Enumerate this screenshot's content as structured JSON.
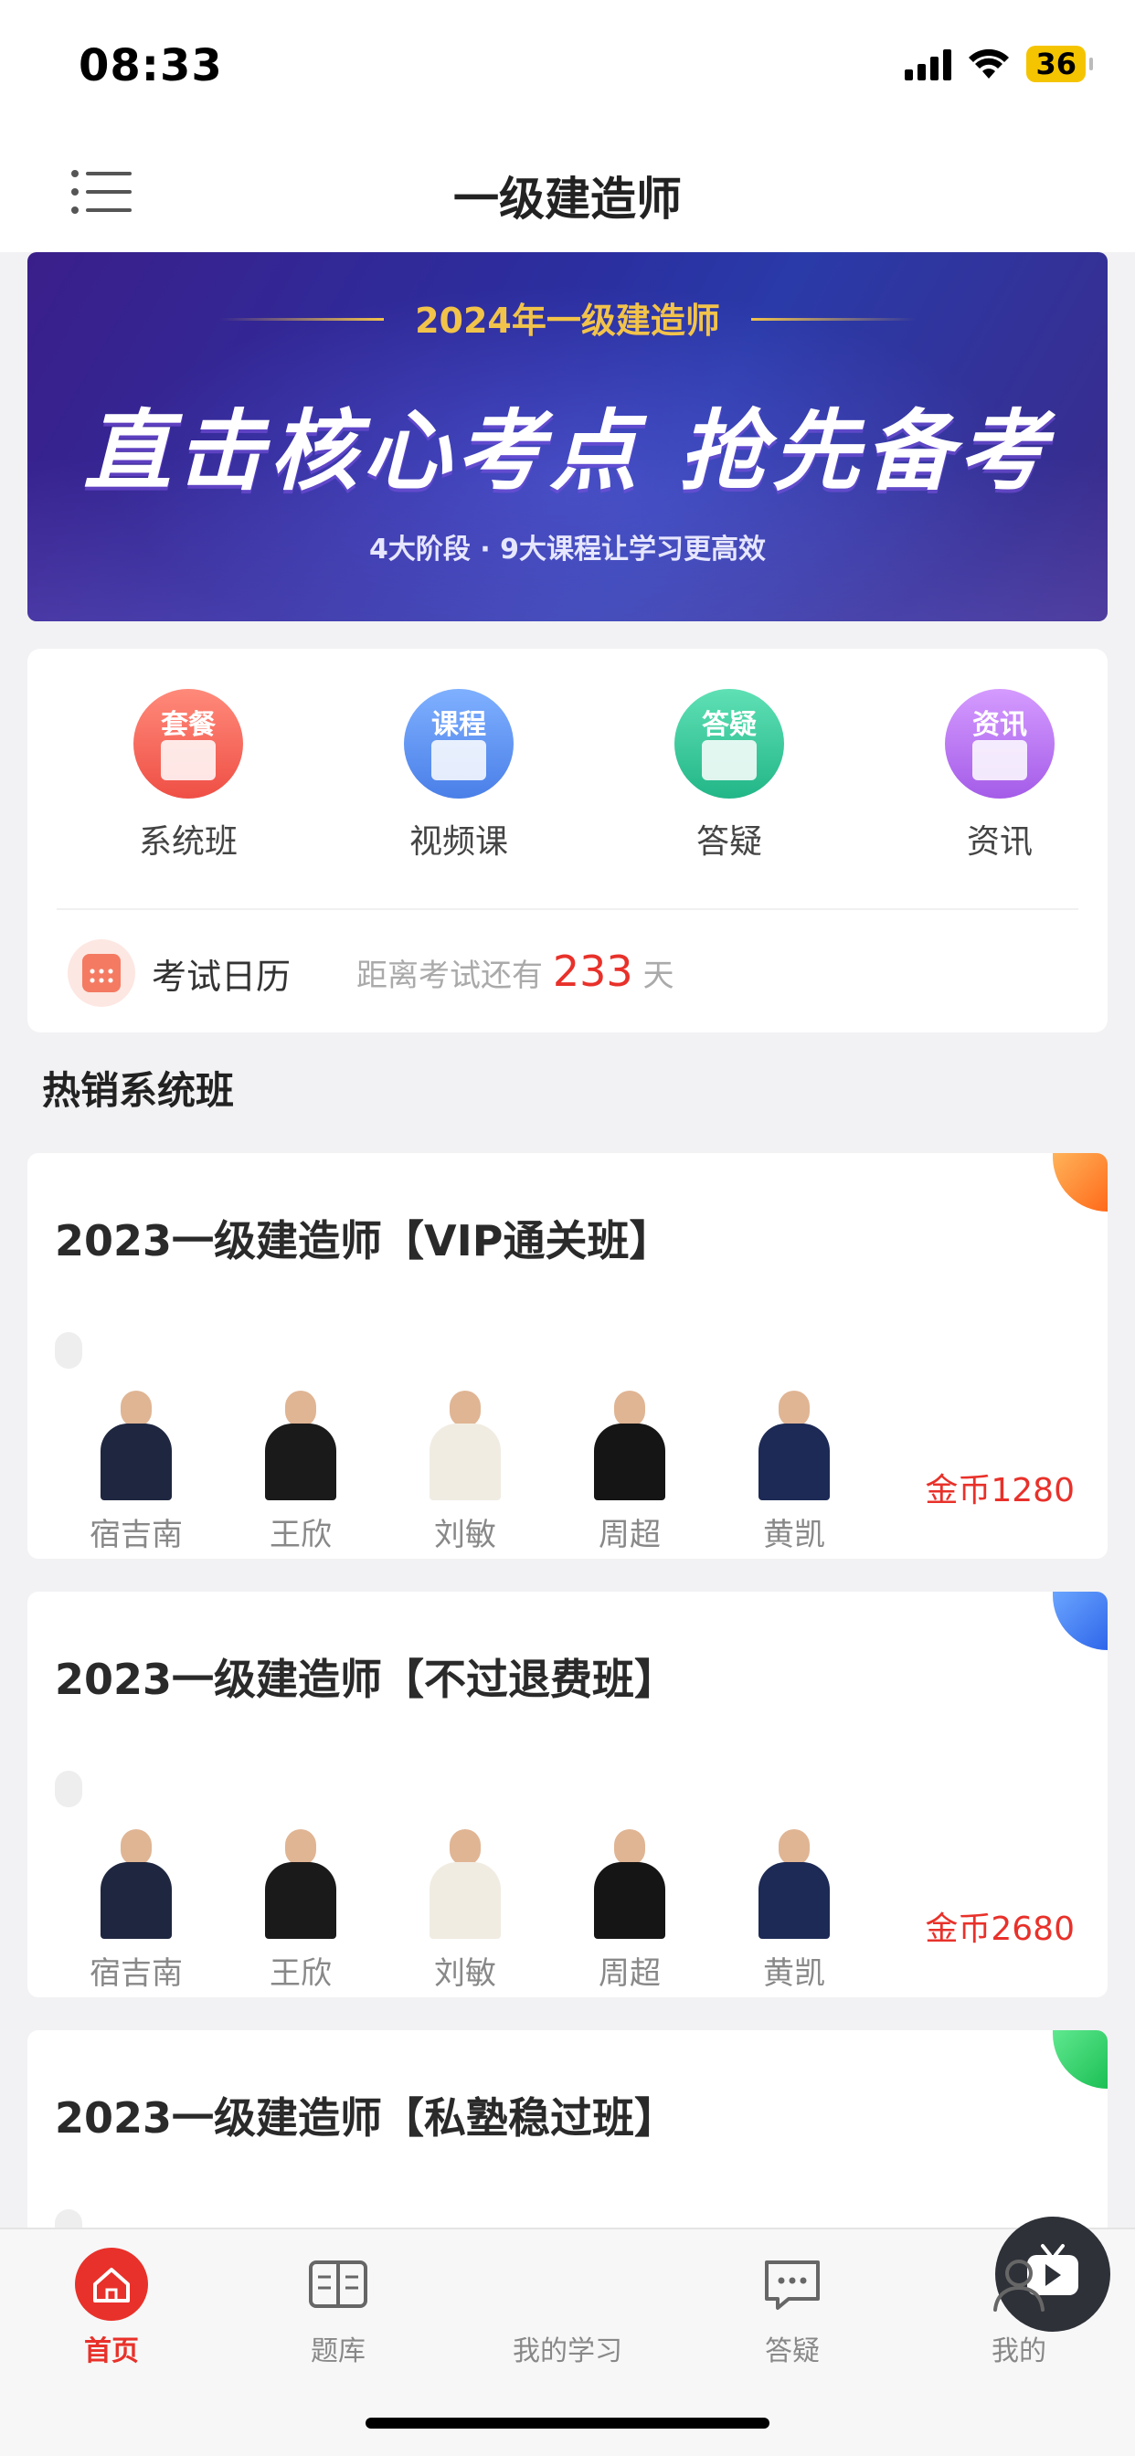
{
  "status_bar": {
    "time": "08:33",
    "battery": "36"
  },
  "nav": {
    "title": "一级建造师"
  },
  "banner": {
    "top_text": "2024年一级建造师",
    "main_text": "直击核心考点  抢先备考",
    "sub_text": "4大阶段 · 9大课程让学习更高效"
  },
  "quick_links": [
    {
      "tag": "套餐",
      "label": "系统班",
      "color": "#f06a5e"
    },
    {
      "tag": "课程",
      "label": "视频课",
      "color": "#5c8ff0"
    },
    {
      "tag": "答疑",
      "label": "答疑",
      "color": "#34c39a"
    },
    {
      "tag": "资讯",
      "label": "资讯",
      "color": "#b372ee"
    }
  ],
  "exam_calendar": {
    "label": "考试日历",
    "prefix": "距离考试还有",
    "days": "233",
    "suffix": "天"
  },
  "section": {
    "title": "热销系统班"
  },
  "courses": [
    {
      "title": "2023一级建造师【VIP通关班】",
      "corner_color": "#ff8a2a",
      "price": "金币1280",
      "teachers": [
        "宿吉南",
        "王欣",
        "刘敏",
        "周超",
        "黄凯"
      ]
    },
    {
      "title": "2023一级建造师【不过退费班】",
      "corner_color": "#3a7af0",
      "price": "金币2680",
      "teachers": [
        "宿吉南",
        "王欣",
        "刘敏",
        "周超",
        "黄凯"
      ]
    },
    {
      "title": "2023一级建造师【私塾稳过班】",
      "corner_color": "#2ecf6a"
    }
  ],
  "tab_bar": {
    "tabs": [
      {
        "label": "首页",
        "icon": "home-icon"
      },
      {
        "label": "题库",
        "icon": "book-icon"
      },
      {
        "label": "我的学习",
        "icon": "tv-play-icon"
      },
      {
        "label": "答疑",
        "icon": "chat-icon"
      },
      {
        "label": "我的",
        "icon": "user-icon"
      }
    ]
  }
}
